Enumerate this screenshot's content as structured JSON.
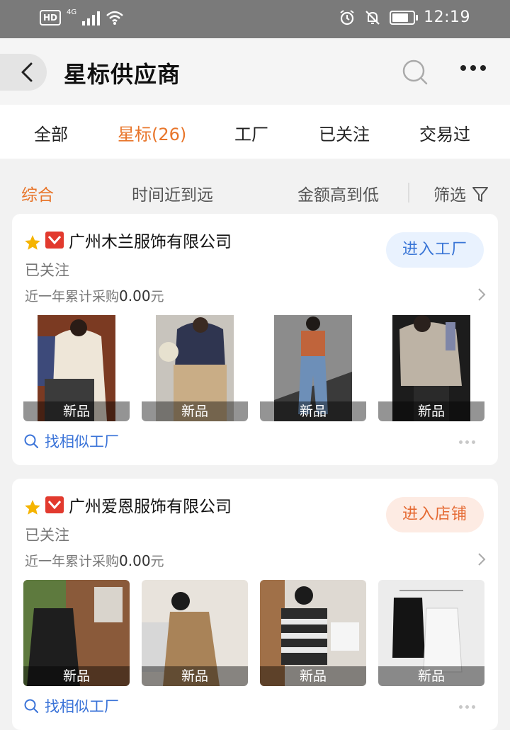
{
  "status_bar": {
    "hd": "HD",
    "network": "4G",
    "time": "12:19"
  },
  "header": {
    "title": "星标供应商"
  },
  "tabs": [
    {
      "label": "全部",
      "active": false
    },
    {
      "label": "星标(26)",
      "active": true
    },
    {
      "label": "工厂",
      "active": false
    },
    {
      "label": "已关注",
      "active": false
    },
    {
      "label": "交易过",
      "active": false
    }
  ],
  "sort": {
    "overall": "综合",
    "time": "时间近到远",
    "amount": "金额高到低",
    "filter": "筛选"
  },
  "colors": {
    "accent": "#e8752a",
    "link": "#3a73d8",
    "enter_blue_bg": "#e9f2fe",
    "enter_orange_bg": "#fdebe3"
  },
  "suppliers": [
    {
      "name": "广州木兰服饰有限公司",
      "follow_status": "已关注",
      "purchase_label": "近一年累计采购",
      "purchase_amount": "0.00",
      "purchase_unit": "元",
      "enter_label": "进入工厂",
      "badge": "新品",
      "similar_label": "找相似工厂"
    },
    {
      "name": "广州爱恩服饰有限公司",
      "follow_status": "已关注",
      "purchase_label": "近一年累计采购",
      "purchase_amount": "0.00",
      "purchase_unit": "元",
      "enter_label": "进入店铺",
      "badge": "新品",
      "similar_label": "找相似工厂"
    }
  ]
}
